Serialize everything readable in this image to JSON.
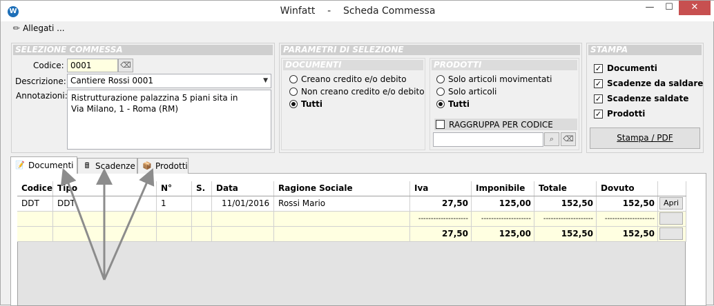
{
  "window": {
    "app_name": "Winfatt",
    "separator": "-",
    "title": "Scheda Commessa",
    "min": "—",
    "max": "☐",
    "close": "✕",
    "app_icon": "W"
  },
  "menu": {
    "allegati": "Allegati ..."
  },
  "selezione": {
    "header": "SELEZIONE COMMESSA",
    "codice_label": "Codice:",
    "codice_value": "0001",
    "descrizione_label": "Descrizione:",
    "descrizione_value": "Cantiere Rossi 0001",
    "annotazioni_label": "Annotazioni:",
    "annotazioni_line1": "Ristrutturazione palazzina 5 piani sita in",
    "annotazioni_line2": "Via Milano, 1 - Roma (RM)"
  },
  "parametri": {
    "header": "PARAMETRI DI SELEZIONE",
    "documenti_header": "DOCUMENTI",
    "documenti_options": [
      "Creano credito e/o debito",
      "Non creano credito e/o debito",
      "Tutti"
    ],
    "prodotti_header": "PRODOTTI",
    "prodotti_options": [
      "Solo articoli movimentati",
      "Solo articoli",
      "Tutti"
    ],
    "raggruppa_label": "RAGGRUPPA PER CODICE"
  },
  "stampa": {
    "header": "STAMPA",
    "checks": [
      "Documenti",
      "Scadenze da saldare",
      "Scadenze saldate",
      "Prodotti"
    ],
    "button": "Stampa / PDF"
  },
  "tabs": [
    "Documenti",
    "Scadenze",
    "Prodotti"
  ],
  "table": {
    "columns": [
      "Codice",
      "Tipo",
      "N°",
      "S.",
      "Data",
      "Ragione Sociale",
      "Iva",
      "Imponibile",
      "Totale",
      "Dovuto"
    ],
    "row": {
      "codice": "DDT",
      "tipo": "DDT",
      "numero": "1",
      "serie": "",
      "data": "11/01/2016",
      "ragione": "Rossi Mario",
      "iva": "27,50",
      "imponibile": "125,00",
      "totale": "152,50",
      "dovuto": "152,50",
      "button": "Apri"
    },
    "separator": "--------------------",
    "totals": {
      "iva": "27,50",
      "imponibile": "125,00",
      "totale": "152,50",
      "dovuto": "152,50"
    }
  },
  "colors": {
    "header_bg": "#cfcfcf",
    "yellow_row": "#ffffe1",
    "close_button": "#c75050",
    "arrow": "#8c8c8c"
  }
}
